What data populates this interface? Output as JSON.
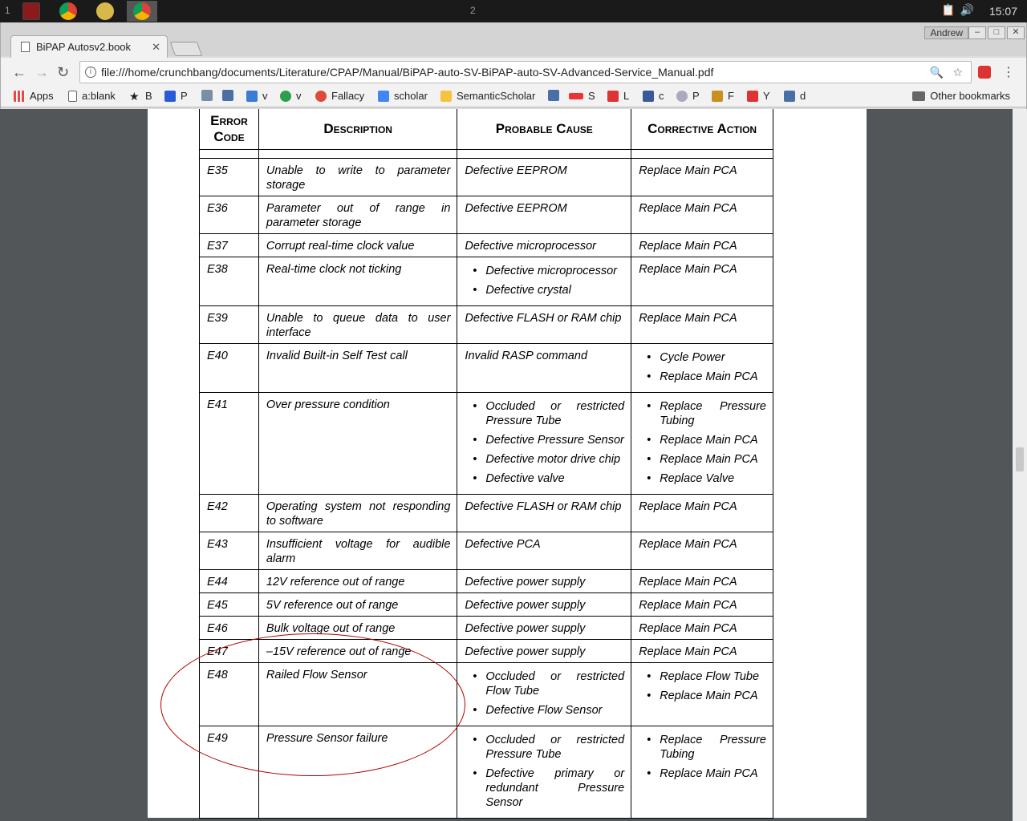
{
  "taskbar": {
    "workspace_1": "1",
    "workspace_2": "2",
    "clock": "15:07"
  },
  "browser": {
    "tab_title": "BiPAP Autosv2.book",
    "profile_name": "Andrew",
    "url": "file:///home/crunchbang/documents/Literature/CPAP/Manual/BiPAP-auto-SV-BiPAP-auto-SV-Advanced-Service_Manual.pdf",
    "bookmarks": [
      {
        "label": "Apps",
        "icon": "apps-grid-icon"
      },
      {
        "label": "a:blank",
        "icon": "page-icon"
      },
      {
        "label": "B",
        "icon": "star-icon"
      },
      {
        "label": "P",
        "icon": "pt-icon"
      },
      {
        "label": "",
        "icon": "satellite-icon"
      },
      {
        "label": "",
        "icon": "ma-icon"
      },
      {
        "label": "v",
        "icon": "check-icon"
      },
      {
        "label": "v",
        "icon": "leaf-icon"
      },
      {
        "label": "Fallacy",
        "icon": "google-plus-icon"
      },
      {
        "label": "scholar",
        "icon": "scholar-icon"
      },
      {
        "label": "SemanticScholar",
        "icon": "semantic-icon"
      },
      {
        "label": "",
        "icon": "ma-icon"
      },
      {
        "label": "S",
        "icon": "smile-icon"
      },
      {
        "label": "L",
        "icon": "mail-icon"
      },
      {
        "label": "c",
        "icon": "facebook-icon"
      },
      {
        "label": "P",
        "icon": "globe-icon"
      },
      {
        "label": "F",
        "icon": "figure-icon"
      },
      {
        "label": "Y",
        "icon": "x-icon"
      },
      {
        "label": "d",
        "icon": "badge-icon"
      }
    ],
    "other_bookmarks": "Other bookmarks"
  },
  "table": {
    "headers": {
      "code": "Error Code",
      "description": "Description",
      "cause": "Probable Cause",
      "action": "Corrective Action"
    },
    "rows": [
      {
        "code": "E35",
        "description": "Unable to write to parameter storage",
        "cause": [
          "Defective EEPROM"
        ],
        "action": [
          "Replace Main PCA"
        ]
      },
      {
        "code": "E36",
        "description": "Parameter out of range in parameter storage",
        "cause": [
          "Defective EEPROM"
        ],
        "action": [
          "Replace Main PCA"
        ]
      },
      {
        "code": "E37",
        "description": "Corrupt real-time clock value",
        "cause": [
          "Defective microprocessor"
        ],
        "action": [
          "Replace Main PCA"
        ]
      },
      {
        "code": "E38",
        "description": "Real-time clock not ticking",
        "cause": [
          "Defective microprocessor",
          "Defective crystal"
        ],
        "action": [
          "Replace Main PCA"
        ]
      },
      {
        "code": "E39",
        "description": "Unable to queue data to user interface",
        "cause": [
          "Defective FLASH or RAM chip"
        ],
        "action": [
          "Replace Main PCA"
        ]
      },
      {
        "code": "E40",
        "description": "Invalid Built-in Self Test call",
        "cause": [
          "Invalid RASP command"
        ],
        "action": [
          "Cycle Power",
          "Replace Main PCA"
        ]
      },
      {
        "code": "E41",
        "description": "Over pressure condition",
        "cause": [
          "Occluded or restricted Pressure Tube",
          "Defective Pressure Sensor",
          "Defective motor drive chip",
          "Defective valve"
        ],
        "action": [
          "Replace Pressure Tubing",
          "Replace Main PCA",
          "Replace Main PCA",
          "Replace Valve"
        ]
      },
      {
        "code": "E42",
        "description": "Operating system not responding to software",
        "cause": [
          "Defective FLASH or RAM chip"
        ],
        "action": [
          "Replace Main PCA"
        ]
      },
      {
        "code": "E43",
        "description": "Insufficient voltage for audible alarm",
        "cause": [
          "Defective PCA"
        ],
        "action": [
          "Replace Main PCA"
        ]
      },
      {
        "code": "E44",
        "description": "12V reference out of range",
        "cause": [
          "Defective power supply"
        ],
        "action": [
          "Replace Main PCA"
        ]
      },
      {
        "code": "E45",
        "description": "5V reference out of range",
        "cause": [
          "Defective power supply"
        ],
        "action": [
          "Replace Main PCA"
        ]
      },
      {
        "code": "E46",
        "description": "Bulk voltage out of range",
        "cause": [
          "Defective power supply"
        ],
        "action": [
          "Replace Main PCA"
        ]
      },
      {
        "code": "E47",
        "description": "–15V reference out of range",
        "cause": [
          "Defective power supply"
        ],
        "action": [
          "Replace Main PCA"
        ]
      },
      {
        "code": "E48",
        "description": "Railed Flow Sensor",
        "cause": [
          "Occluded or restricted Flow Tube",
          "Defective Flow Sensor"
        ],
        "action": [
          "Replace Flow Tube",
          "Replace Main PCA"
        ]
      },
      {
        "code": "E49",
        "description": "Pressure Sensor failure",
        "cause": [
          "Occluded or restricted Pressure Tube",
          "Defective primary or redundant Pressure Sensor"
        ],
        "action": [
          "Replace Pressure Tubing",
          "Replace Main PCA"
        ]
      }
    ]
  },
  "colors": {
    "annotation": "#b00000",
    "viewer_background": "#525659"
  }
}
